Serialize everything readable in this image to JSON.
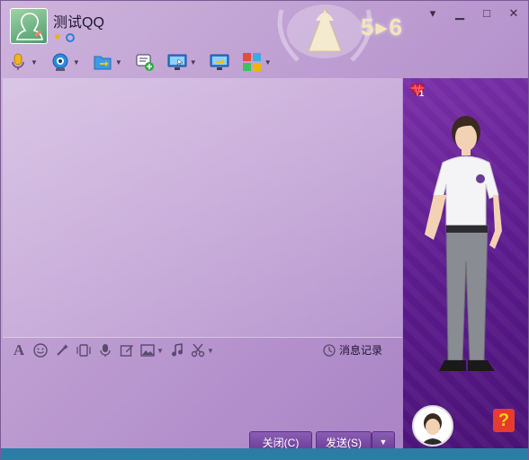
{
  "window": {
    "contact_name": "测试QQ",
    "level_badge": "5▸6"
  },
  "window_controls": [
    "minimize",
    "maximize",
    "close"
  ],
  "toolbar": {
    "items": [
      {
        "icon": "microphone-icon",
        "has_dropdown": true
      },
      {
        "icon": "camera-icon",
        "has_dropdown": true
      },
      {
        "icon": "file-transfer-icon",
        "has_dropdown": true
      },
      {
        "icon": "new-chat-icon",
        "has_dropdown": false
      },
      {
        "icon": "remote-desktop-icon",
        "has_dropdown": true
      },
      {
        "icon": "share-screen-icon",
        "has_dropdown": false
      },
      {
        "icon": "apps-icon",
        "has_dropdown": true
      }
    ]
  },
  "input_toolbar": {
    "items": [
      "font-icon",
      "emoji-icon",
      "magic-icon",
      "vibrate-icon",
      "voice-icon",
      "edit-icon",
      "image-icon",
      "music-icon",
      "scissors-icon"
    ]
  },
  "history": {
    "label": "消息记录"
  },
  "buttons": {
    "close_label": "关闭(C)",
    "send_label": "发送(S)"
  },
  "show_panel": {
    "gem_count": "1",
    "help_label": "?"
  },
  "colors": {
    "accent": "#6a3b97",
    "panel_bg": "#5b1b8c",
    "window_bg": "#bb9ad0"
  }
}
